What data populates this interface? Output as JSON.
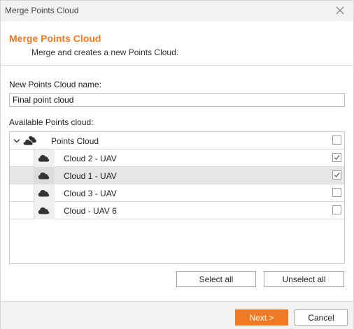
{
  "window": {
    "title": "Merge Points Cloud"
  },
  "header": {
    "title": "Merge Points Cloud",
    "subtitle": "Merge and creates a new Points Cloud."
  },
  "form": {
    "name_label": "New Points Cloud name:",
    "name_value": "Final point cloud",
    "available_label": "Available Points cloud:"
  },
  "tree": {
    "root": {
      "label": "Points Cloud",
      "checked": false,
      "expanded": true
    },
    "items": [
      {
        "label": "Cloud 2 - UAV",
        "checked": true,
        "selected": false
      },
      {
        "label": "Cloud 1 - UAV",
        "checked": true,
        "selected": true
      },
      {
        "label": "Cloud 3 - UAV",
        "checked": false,
        "selected": false
      },
      {
        "label": "Cloud - UAV 6",
        "checked": false,
        "selected": false
      }
    ]
  },
  "actions": {
    "select_all": "Select all",
    "unselect_all": "Unselect all",
    "next": "Next >",
    "cancel": "Cancel"
  },
  "colors": {
    "accent": "#f07a23"
  }
}
